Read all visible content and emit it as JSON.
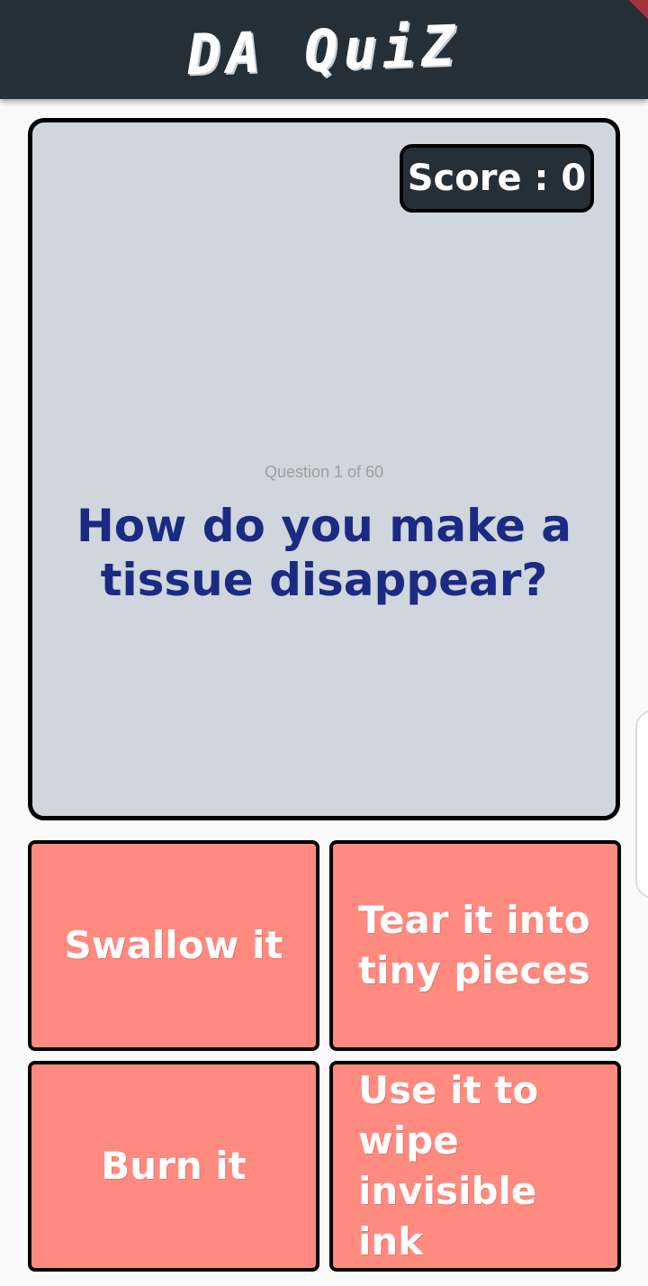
{
  "app": {
    "title": "DA QuiZ"
  },
  "score": {
    "label": "Score : 0"
  },
  "question": {
    "progress": "Question 1 of 60",
    "text": "How do you make a tissue disappear?"
  },
  "answers": [
    {
      "label": "Swallow it"
    },
    {
      "label": "Tear it into tiny pieces"
    },
    {
      "label": "Burn it"
    },
    {
      "label": "Use it to wipe invisible ink"
    }
  ],
  "colors": {
    "appbar": "#252f37",
    "card": "#cfd6dd",
    "question_text": "#1b2a82",
    "answer_bg": "#ff8a80"
  }
}
